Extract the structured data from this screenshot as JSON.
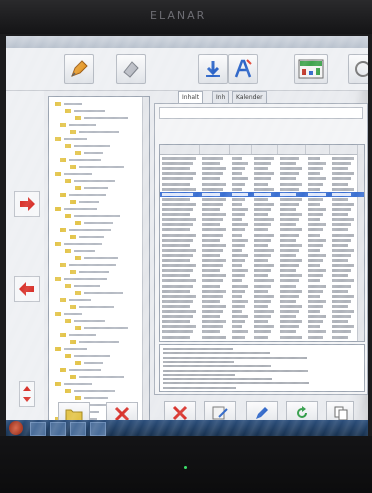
{
  "monitor": {
    "brand": "ELANAR"
  },
  "tabs": [
    {
      "label": "Inhalt"
    },
    {
      "label": "Inh"
    },
    {
      "label": "Kalender"
    }
  ],
  "colors": {
    "selection": "#3a6fd1",
    "delete_red": "#d8322b",
    "arrow_red": "#d8322b",
    "taskbar": "#2c4f7c"
  },
  "icons": {
    "toolbar": [
      "pencil-icon",
      "eraser-icon",
      "download-icon",
      "font-icon",
      "chart-icon",
      "settings-icon"
    ],
    "nav": [
      "arrow-right-icon",
      "arrow-left-icon",
      "sort-icon"
    ],
    "actions": [
      "folder-icon",
      "delete-icon",
      "edit-icon",
      "refresh-icon",
      "copy-icon",
      "print-icon"
    ]
  }
}
